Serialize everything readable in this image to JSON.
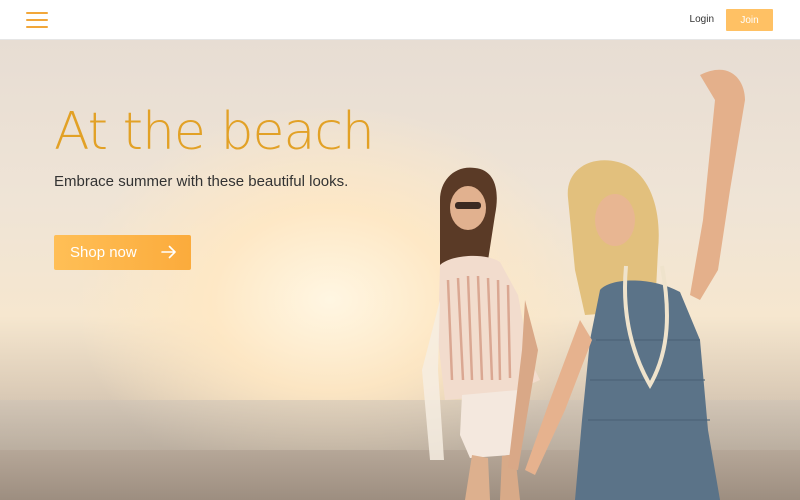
{
  "header": {
    "menu_icon": "hamburger-menu-icon",
    "login_label": "Login",
    "join_label": "Join"
  },
  "hero": {
    "title": "At the beach",
    "subtitle": "Embrace summer with these beautiful looks.",
    "cta_label": "Shop now",
    "cta_icon": "arrow-right-icon",
    "image": "two-women-dancing-on-beach-photo"
  },
  "colors": {
    "accent": "#e2a126",
    "button": "#ffbf56",
    "join_button": "#ffc164"
  }
}
